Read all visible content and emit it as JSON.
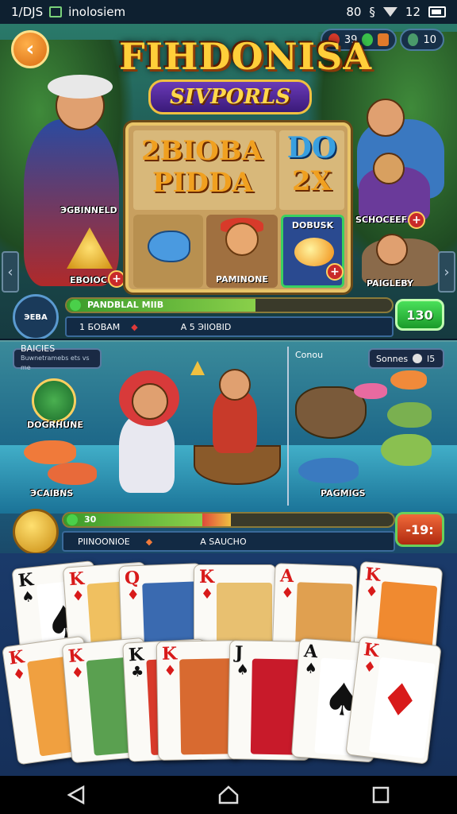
{
  "status_bar": {
    "left_text": "1/DJS",
    "app_text": "inolosiem",
    "right_time": "80",
    "right_battery": "12"
  },
  "top": {
    "logo_title": "FIHDONISA",
    "logo_subtitle": "SIVPORLS",
    "resources": {
      "a_value": "39",
      "b_value": "10"
    },
    "reel_text_1": "2BIOBA",
    "reel_text_2": "PIDDA",
    "reel_do": "DO",
    "reel_2x": "2X",
    "symbol_2_label": "PAMINONE",
    "symbol_3_label": "DOBUSK",
    "left_char_label": "ЭGBINNELD",
    "left_sym_label": "EBOIOC",
    "right_char_label": "SCHOCEEF",
    "right_char_label_2": "PAIGLEBY",
    "shield_label": "ЭEBA",
    "bar_label": "PANDBLAL MIIB",
    "bar_progress": 0.58,
    "info_1": "1 БOBAM",
    "info_2": "A 5 ЭIIOBID",
    "go_value": "130"
  },
  "middle": {
    "tag_left_title": "BAICIES",
    "tag_left_sub": "Buwnetramebs ets vs me",
    "tag_right_label": "Sonnes",
    "tag_right_value": "l5",
    "conn_label": "Conou",
    "left_badge_label": "DOGRHUNE",
    "left_fish_label": "ЭCAIBNS",
    "right_fish_label": "PAGMIGS",
    "bar_label": "30",
    "bar_progress": 0.42,
    "info_1": "PIINOONIOE",
    "info_2": "A SAUCHO",
    "red_value": "-19:"
  },
  "cards": {
    "row1": [
      {
        "rank": "K",
        "suit": "♠",
        "color": "black",
        "art": "#ffffff"
      },
      {
        "rank": "K",
        "suit": "♦",
        "color": "red",
        "art": "#f0c060"
      },
      {
        "rank": "Q",
        "suit": "♦",
        "color": "red",
        "art": "#3a6ab0"
      },
      {
        "rank": "K",
        "suit": "♦",
        "color": "red",
        "art": "#e8c070"
      },
      {
        "rank": "A",
        "suit": "♦",
        "color": "red",
        "art": "#e0a050"
      },
      {
        "rank": "K",
        "suit": "♦",
        "color": "red",
        "art": "#f08a30"
      }
    ],
    "row2": [
      {
        "rank": "K",
        "suit": "♦",
        "color": "red",
        "art": "#f0a040"
      },
      {
        "rank": "K",
        "suit": "♦",
        "color": "red",
        "art": "#5aa050"
      },
      {
        "rank": "K",
        "suit": "♣",
        "color": "black",
        "art": "#d83a2a"
      },
      {
        "rank": "K",
        "suit": "♦",
        "color": "red",
        "art": "#d86a30"
      },
      {
        "rank": "J",
        "suit": "♠",
        "color": "black",
        "art": "#c81a2a"
      },
      {
        "rank": "A",
        "suit": "♠",
        "color": "black",
        "art": "#ffffff"
      },
      {
        "rank": "K",
        "suit": "♦",
        "color": "red",
        "art": "#ffffff"
      }
    ]
  }
}
